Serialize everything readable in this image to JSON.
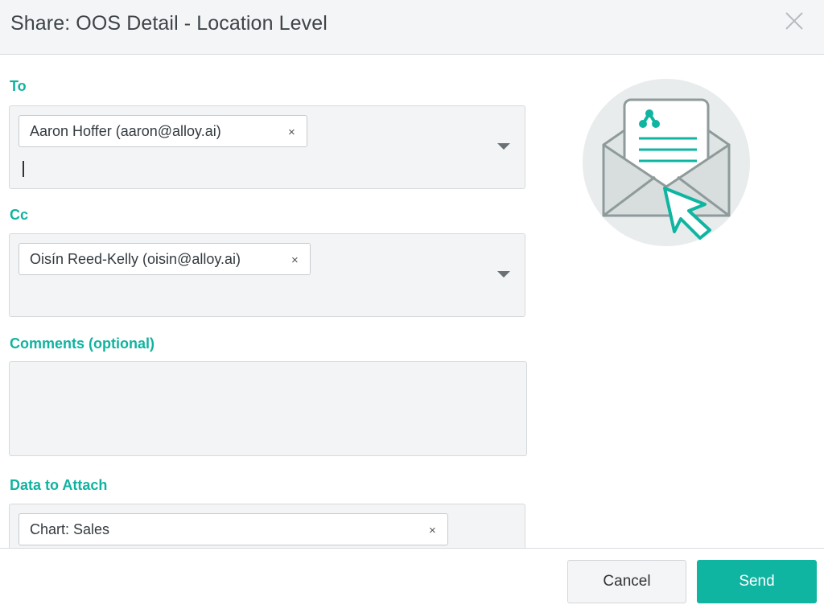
{
  "dialog": {
    "title": "Share: OOS Detail - Location Level"
  },
  "to": {
    "label": "To",
    "recipients": [
      {
        "text": "Aaron Hoffer (aaron@alloy.ai)",
        "remove": "×"
      }
    ]
  },
  "cc": {
    "label": "Cc",
    "recipients": [
      {
        "text": "Oisín Reed-Kelly (oisin@alloy.ai)",
        "remove": "×"
      }
    ]
  },
  "comments": {
    "label": "Comments (optional)",
    "value": ""
  },
  "attachments": {
    "label": "Data to Attach",
    "items": [
      {
        "text": "Chart: Sales",
        "remove": "×"
      }
    ]
  },
  "footer": {
    "cancel_label": "Cancel",
    "send_label": "Send"
  },
  "colors": {
    "accent": "#10b5a1",
    "illustration_bg": "#e8ecec",
    "illustration_line": "#8f9a9b"
  },
  "icons": {
    "close": "close-icon",
    "dropdown": "chevron-down-icon",
    "illustration": "envelope-with-cursor-icon"
  }
}
